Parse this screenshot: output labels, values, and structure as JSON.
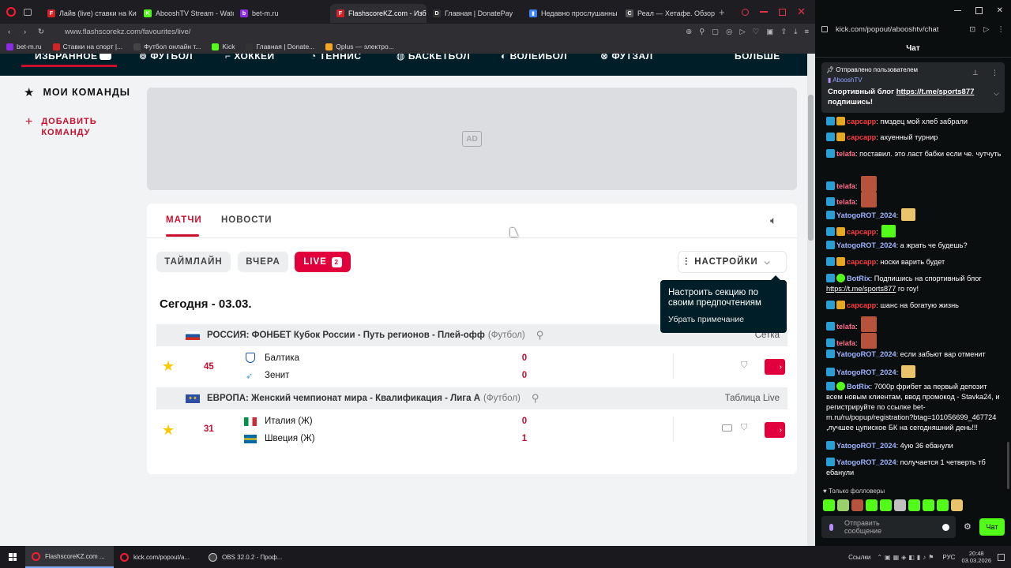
{
  "browser_left": {
    "tabs": [
      {
        "label": "Лайв (live) ставки на Ки",
        "color": "#d1232a",
        "icon_text": "F"
      },
      {
        "label": "AbooshTV Stream - Watc",
        "color": "#53fc18",
        "icon_text": "K"
      },
      {
        "label": "bet-m.ru",
        "color": "#8b2be2",
        "icon_text": "b"
      },
      {
        "label": "FlashscoreKZ.com - Избр",
        "color": "#d1232a",
        "icon_text": "F",
        "active": true
      },
      {
        "label": "Главная | DonatePay",
        "color": "#333333",
        "icon_text": "D"
      },
      {
        "label": "Недавно прослушанны",
        "color": "#3b82f6",
        "icon_text": "▮"
      },
      {
        "label": "Реал — Хетафе. Обзор м",
        "color": "#555555",
        "icon_text": "C"
      }
    ],
    "url": "www.flashscorekz.com/favourites/live/",
    "bookmarks": [
      {
        "label": "bet-m.ru",
        "color": "#8b2be2"
      },
      {
        "label": "Ставки на спорт |...",
        "color": "#d1232a"
      },
      {
        "label": "Футбол онлайн т...",
        "color": "#444444"
      },
      {
        "label": "Kick",
        "color": "#53fc18"
      },
      {
        "label": "Главная | Donate...",
        "color": "#333333"
      },
      {
        "label": "Qplus — электро...",
        "color": "#f5a623"
      }
    ]
  },
  "site": {
    "sports_nav": [
      "ИЗБРАННОЕ",
      "ФУТБОЛ",
      "ХОККЕЙ",
      "ТЕННИС",
      "БАСКЕТБОЛ",
      "ВОЛЕЙБОЛ",
      "ФУТЗАЛ",
      "БОЛЬШЕ"
    ],
    "sidebar": {
      "my_teams": "МОИ КОМАНДЫ",
      "add_team_line1": "ДОБАВИТЬ",
      "add_team_line2": "КОМАНДУ"
    },
    "ad_label": "AD",
    "tabs": {
      "matches": "МАТЧИ",
      "news": "НОВОСТИ"
    },
    "filters": {
      "timeline": "ТАЙМЛАЙН",
      "yesterday": "ВЧЕРА",
      "live": "LIVE",
      "live_count": "2",
      "settings": "НАСТРОЙКИ"
    },
    "tooltip": {
      "text_line1": "Настроить секцию по",
      "text_line2": "своим предпочтениям",
      "dismiss": "Убрать примечание"
    },
    "date_heading": "Сегодня - 03.03.",
    "leagues": [
      {
        "name": "РОССИЯ: ФОНБЕТ Кубок России - Путь регионов - Плей-офф",
        "sport": "(Футбол)",
        "right_link": "Сетка",
        "match": {
          "minute": "45",
          "home": "Балтика",
          "away": "Зенит",
          "home_score": "0",
          "away_score": "0"
        }
      },
      {
        "name": "ЕВРОПА: Женский чемпионат мира - Квалификация - Лига А",
        "sport": "(Футбол)",
        "right_link": "Таблица Live",
        "match": {
          "minute": "31",
          "home": "Италия (Ж)",
          "away": "Швеция (Ж)",
          "home_score": "0",
          "away_score": "1"
        }
      }
    ]
  },
  "browser_right": {
    "url": "kick.com/popout/abooshtv/chat",
    "chat_title": "Чат",
    "pinned": {
      "header": "Отправлено пользователем",
      "user": "AbooshTV",
      "text": "Спортивный блог ",
      "link": "https://t.me/sports877",
      "text2": "подпишись!"
    },
    "messages": [
      {
        "user": "capcapp",
        "color": "#ff3b3b",
        "badges": [
          "blue",
          "crown"
        ],
        "text": ": пмздец мой хлеб забрали"
      },
      {
        "user": "capcapp",
        "color": "#ff3b3b",
        "badges": [
          "blue",
          "crown"
        ],
        "text": ": ахуенный турнир"
      },
      {
        "user": "telafa",
        "color": "#ff6b8a",
        "badges": [
          "blue"
        ],
        "text": ": поставил. это ласт бабки если че. чутчуть"
      },
      {
        "user": "telafa",
        "color": "#ff6b8a",
        "badges": [
          "blue"
        ],
        "text": ":",
        "emote": true
      },
      {
        "user": "telafa",
        "color": "#ff6b8a",
        "badges": [
          "blue"
        ],
        "text": ":",
        "emote": true
      },
      {
        "user": "YatogoROT_2024",
        "color": "#9fb4ff",
        "badges": [
          "blue"
        ],
        "text": ":",
        "emote": true
      },
      {
        "user": "capcapp",
        "color": "#ff3b3b",
        "badges": [
          "blue",
          "crown"
        ],
        "text": ":",
        "emote": true
      },
      {
        "user": "YatogoROT_2024",
        "color": "#9fb4ff",
        "badges": [
          "blue"
        ],
        "text": ": а жрать че будешь?"
      },
      {
        "user": "capcapp",
        "color": "#ff3b3b",
        "badges": [
          "blue",
          "crown"
        ],
        "text": ": носки варить будет"
      },
      {
        "user": "BotRix",
        "color": "#9fb4ff",
        "badges": [
          "blue",
          "green"
        ],
        "text": ": Подпишись на спортивный блог ",
        "link": "https://t.me/sports877",
        "text2": " го гоу!"
      },
      {
        "user": "capcapp",
        "color": "#ff3b3b",
        "badges": [
          "blue",
          "crown"
        ],
        "text": ": шанс на богатую жизнь"
      },
      {
        "user": "telafa",
        "color": "#ff6b8a",
        "badges": [
          "blue"
        ],
        "text": ":",
        "emote": true
      },
      {
        "user": "telafa",
        "color": "#ff6b8a",
        "badges": [
          "blue"
        ],
        "text": ":",
        "emote": true
      },
      {
        "user": "YatogoROT_2024",
        "color": "#9fb4ff",
        "badges": [
          "blue"
        ],
        "text": ": если забьют вар отменит"
      },
      {
        "user": "YatogoROT_2024",
        "color": "#9fb4ff",
        "badges": [
          "blue"
        ],
        "text": ":",
        "emote": true
      },
      {
        "user": "BotRix",
        "color": "#9fb4ff",
        "badges": [
          "blue",
          "green"
        ],
        "text": ": 7000р фрибет за первый депозит всем новым клиентам, ввод промокод - Stavka24, и регистрируйте по ссылке bet-m.ru/ru/popup/registration?btag=101056699_467724 ,лучшее цупиское БК на сегодняшний день!!!"
      },
      {
        "user": "YatogoROT_2024",
        "color": "#9fb4ff",
        "badges": [
          "blue"
        ],
        "text": ": 4ую 36 ебанули"
      },
      {
        "user": "YatogoROT_2024",
        "color": "#9fb4ff",
        "badges": [
          "blue"
        ],
        "text": ": получается 1 четверть тб ебанули"
      }
    ],
    "followers_only": "Только фолловеры",
    "input_placeholder_line1": "Отправить",
    "input_placeholder_line2": "сообщение",
    "send_label": "Чат"
  },
  "taskbar": {
    "items": [
      "FlashscoreKZ.com ...",
      "kick.com/popout/a...",
      "OBS 32.0.2 - Проф..."
    ],
    "tray_links": "Ссылки",
    "lang": "РУС",
    "time": "20:48",
    "date": "03.03.2026"
  }
}
